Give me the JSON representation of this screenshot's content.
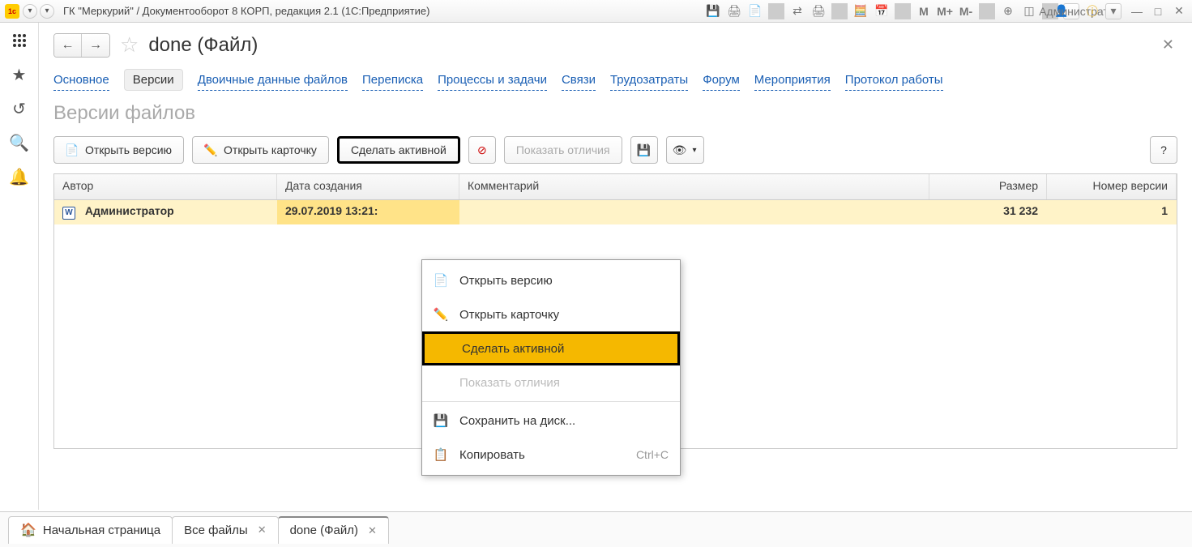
{
  "titlebar": {
    "app_title": "ГК \"Меркурий\" / Документооборот 8 КОРП, редакция 2.1  (1С:Предприятие)",
    "user_label": "Администратор",
    "m_buttons": [
      "M",
      "M+",
      "M-"
    ]
  },
  "page": {
    "title": "done (Файл)"
  },
  "tabs": {
    "items": [
      "Основное",
      "Версии",
      "Двоичные данные файлов",
      "Переписка",
      "Процессы и задачи",
      "Связи",
      "Трудозатраты",
      "Форум",
      "Мероприятия",
      "Протокол работы"
    ],
    "active_index": 1
  },
  "subheader": "Версии файлов",
  "toolbar": {
    "open_version": "Открыть версию",
    "open_card": "Открыть карточку",
    "make_active": "Сделать активной",
    "show_diff": "Показать отличия",
    "help": "?"
  },
  "grid": {
    "headers": {
      "author": "Автор",
      "date": "Дата создания",
      "comment": "Комментарий",
      "size": "Размер",
      "version": "Номер версии"
    },
    "rows": [
      {
        "author": "Администратор",
        "date": "29.07.2019 13:21:",
        "comment": "",
        "size": "31 232",
        "version": "1"
      }
    ]
  },
  "context_menu": {
    "open_version": "Открыть версию",
    "open_card": "Открыть карточку",
    "make_active": "Сделать активной",
    "show_diff": "Показать отличия",
    "save_to_disk": "Сохранить на диск...",
    "copy": "Копировать",
    "copy_shortcut": "Ctrl+C"
  },
  "bottom_tabs": {
    "home": "Начальная страница",
    "tabs": [
      {
        "label": "Все файлы",
        "closable": true
      },
      {
        "label": "done (Файл)",
        "closable": true,
        "active": true
      }
    ]
  }
}
